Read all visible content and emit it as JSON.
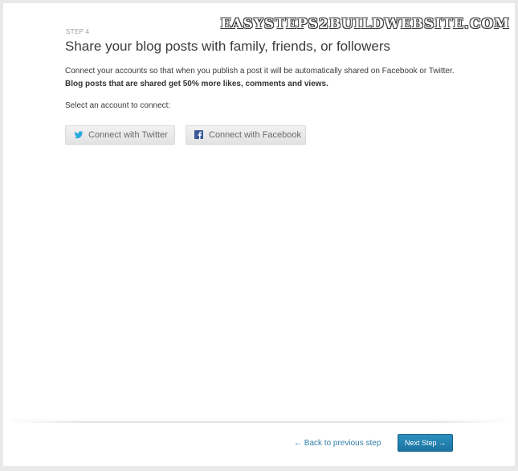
{
  "watermark": "EASYSTEPS2BUILDWEBSITE.COM",
  "step_label": "STEP 4",
  "title": "Share your blog posts with family, friends, or followers",
  "intro": {
    "text": "Connect your accounts so that when you publish a post it will be automatically shared on Facebook or Twitter.",
    "bold": "Blog posts that are shared get 50% more likes, comments and views."
  },
  "select_label": "Select an account to connect:",
  "buttons": {
    "twitter": {
      "label": "Connect with Twitter",
      "icon": "twitter-bird-icon"
    },
    "facebook": {
      "label": "Connect with Facebook",
      "icon": "facebook-f-icon"
    }
  },
  "footer": {
    "back_label": "← Back to previous step",
    "next_label": "Next Step →"
  },
  "colors": {
    "accent": "#1e7bab",
    "link": "#2f7fa8",
    "twitter_icon": "#2aa9e0",
    "facebook_icon": "#3b5998"
  }
}
